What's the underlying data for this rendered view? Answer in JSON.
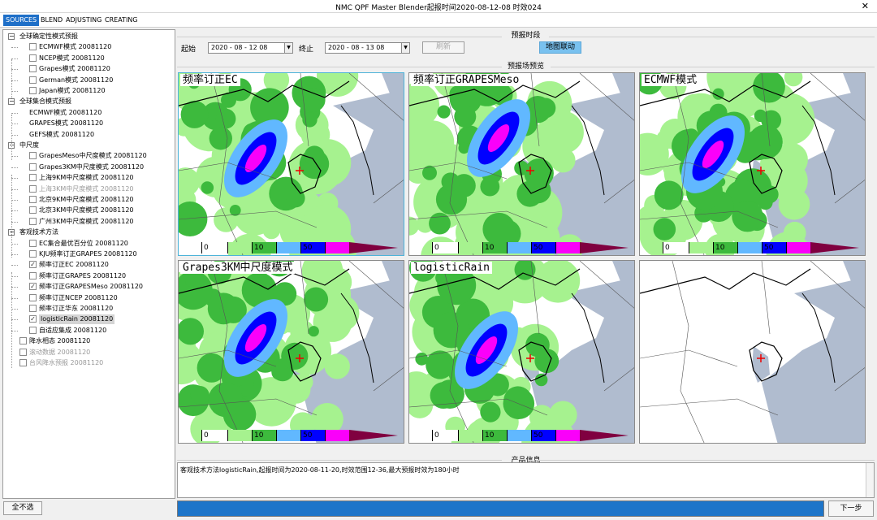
{
  "window": {
    "title": "NMC QPF Master Blender起报时间2020-08-12-08 时效024",
    "close": "✕"
  },
  "menu": [
    "SOURCES",
    "BLEND",
    "ADJUSTING",
    "CREATING"
  ],
  "tree": [
    {
      "t": "全球确定性模式预报",
      "lvl": 0,
      "exp": "⊟",
      "chk": null
    },
    {
      "t": "ECMWF模式  20081120",
      "lvl": 1,
      "chk": ""
    },
    {
      "t": "NCEP模式  20081120",
      "lvl": 1,
      "chk": ""
    },
    {
      "t": "Grapes模式  20081120",
      "lvl": 1,
      "chk": ""
    },
    {
      "t": "German模式  20081120",
      "lvl": 1,
      "chk": ""
    },
    {
      "t": "Japan模式  20081120",
      "lvl": 1,
      "chk": ""
    },
    {
      "t": "全球集合模式预报",
      "lvl": 0,
      "exp": "⊟",
      "chk": null
    },
    {
      "t": "ECMWF模式  20081120",
      "lvl": 1,
      "chk": null
    },
    {
      "t": "GRAPES模式  20081120",
      "lvl": 1,
      "chk": null
    },
    {
      "t": "GEFS模式  20081120",
      "lvl": 1,
      "chk": null
    },
    {
      "t": "中尺度",
      "lvl": 0,
      "exp": "⊟",
      "chk": null
    },
    {
      "t": "GrapesMeso中尺度模式  20081120",
      "lvl": 1,
      "chk": ""
    },
    {
      "t": "Grapes3KM中尺度模式  20081120",
      "lvl": 1,
      "chk": ""
    },
    {
      "t": "上海9KM中尺度模式  20081120",
      "lvl": 1,
      "chk": ""
    },
    {
      "t": "上海3KM中尺度模式  20081120",
      "lvl": 1,
      "chk": "",
      "gray": true
    },
    {
      "t": "北京9KM中尺度模式  20081120",
      "lvl": 1,
      "chk": ""
    },
    {
      "t": "北京3KM中尺度模式  20081120",
      "lvl": 1,
      "chk": ""
    },
    {
      "t": "广州3KM中尺度模式  20081120",
      "lvl": 1,
      "chk": ""
    },
    {
      "t": "客观技术方法",
      "lvl": 0,
      "exp": "⊟",
      "chk": null
    },
    {
      "t": "EC集合最优百分位  20081120",
      "lvl": 1,
      "chk": ""
    },
    {
      "t": "KJU频率订正GRAPES  20081120",
      "lvl": 1,
      "chk": ""
    },
    {
      "t": "频率订正EC  20081120",
      "lvl": 1,
      "chk": "✓"
    },
    {
      "t": "频率订正GRAPES  20081120",
      "lvl": 1,
      "chk": ""
    },
    {
      "t": "频率订正GRAPESMeso  20081120",
      "lvl": 1,
      "chk": "✓"
    },
    {
      "t": "频率订正NCEP  20081120",
      "lvl": 1,
      "chk": ""
    },
    {
      "t": "频率订正华东  20081120",
      "lvl": 1,
      "chk": ""
    },
    {
      "t": "logisticRain  20081120",
      "lvl": 1,
      "chk": "✓",
      "sel": true
    },
    {
      "t": "自适应集成  20081120",
      "lvl": 1,
      "chk": ""
    },
    {
      "t": "降水相态  20081120",
      "lvl": 0,
      "chk": ""
    },
    {
      "t": "滚动数据  20081120",
      "lvl": 0,
      "chk": "",
      "gray": true
    },
    {
      "t": "台风降水预报  20081120",
      "lvl": 0,
      "chk": "",
      "gray": true
    }
  ],
  "left_button": "全不选",
  "time": {
    "group": "预报时段",
    "start_label": "起始",
    "start_value": "2020 - 08 - 12   08",
    "end_label": "终止",
    "end_value": "2020 - 08 - 13   08",
    "refresh": "刷新",
    "map_link": "地图联动"
  },
  "preview_title": "预报场预览",
  "maps": [
    {
      "label": "频率订正EC",
      "rain": true
    },
    {
      "label": "频率订正GRAPESMeso",
      "rain": true
    },
    {
      "label": "ECMWF模式",
      "rain": true
    },
    {
      "label": "Grapes3KM中尺度模式",
      "rain": true
    },
    {
      "label": "logisticRain",
      "rain": true
    },
    {
      "label": "",
      "rain": false
    }
  ],
  "colorbar": {
    "ticks": [
      "0",
      "10",
      "50"
    ],
    "colors": [
      "#ffffff",
      "#a6f28f",
      "#3dba3d",
      "#61b8ff",
      "#0000ff",
      "#fa00fa",
      "#800040"
    ]
  },
  "info": {
    "title": "产品信息",
    "text": "客观技术方法logisticRain,起报时间为2020-08-11-20,时效范围12-36,最大预报时效为180小时"
  },
  "next_button": "下一步"
}
